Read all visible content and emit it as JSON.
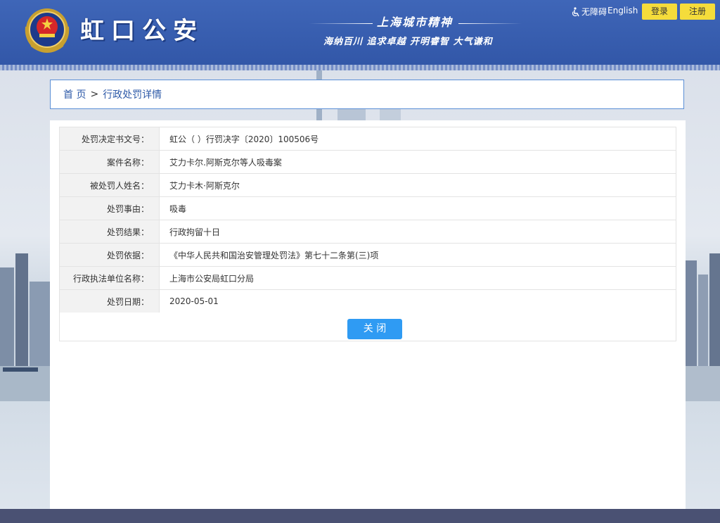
{
  "header": {
    "site_name": "虹口公安",
    "spirit_title": "上海城市精神",
    "spirit_sub": "海纳百川 追求卓越 开明睿智 大气谦和",
    "accessible": "无障碍",
    "english": "English",
    "login": "登录",
    "register": "注册"
  },
  "breadcrumb": {
    "home": "首 页",
    "sep": ">",
    "current": "行政处罚详情"
  },
  "details": [
    {
      "label": "处罚决定书文号：",
      "value": "虹公（ ）行罚决字〔2020〕100506号"
    },
    {
      "label": "案件名称：",
      "value": "艾力卡尔.阿斯克尔等人吸毒案"
    },
    {
      "label": "被处罚人姓名：",
      "value": "艾力卡木·阿斯克尔"
    },
    {
      "label": "处罚事由：",
      "value": "吸毒"
    },
    {
      "label": "处罚结果：",
      "value": "行政拘留十日"
    },
    {
      "label": "处罚依据：",
      "value": "《中华人民共和国治安管理处罚法》第七十二条第(三)项"
    },
    {
      "label": "行政执法单位名称：",
      "value": "上海市公安局虹口分局"
    },
    {
      "label": "处罚日期：",
      "value": "2020-05-01"
    }
  ],
  "close_button": "关 闭",
  "colors": {
    "header_blue": "#3f66b8",
    "button_yellow": "#f5dc3b",
    "close_blue": "#2f9bf3",
    "footer": "#4a5173"
  },
  "icons": [
    "police-emblem-icon",
    "wheelchair-icon"
  ]
}
